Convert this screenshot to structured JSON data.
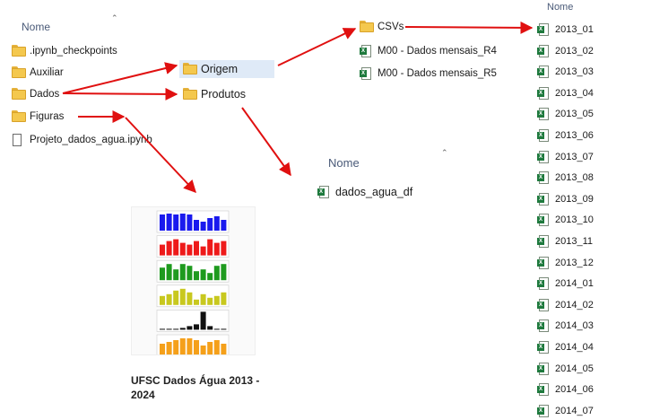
{
  "left_pane": {
    "header": "Nome",
    "items": [
      {
        "label": ".ipynb_checkpoints",
        "icon": "folder-icon"
      },
      {
        "label": "Auxiliar",
        "icon": "folder-icon"
      },
      {
        "label": "Dados",
        "icon": "folder-icon"
      },
      {
        "label": "Figuras",
        "icon": "folder-icon"
      },
      {
        "label": "Projeto_dados_agua.ipynb",
        "icon": "notebook-file-icon"
      }
    ]
  },
  "dados_pane": {
    "items": [
      {
        "label": "Origem",
        "icon": "folder-icon",
        "selected": true
      },
      {
        "label": "Produtos",
        "icon": "folder-icon"
      }
    ]
  },
  "origem_pane": {
    "items": [
      {
        "label": "CSVs",
        "icon": "folder-icon"
      },
      {
        "label": "M00 - Dados mensais_R4",
        "icon": "excel-file-icon"
      },
      {
        "label": "M00 - Dados mensais_R5",
        "icon": "excel-file-icon"
      }
    ]
  },
  "produtos_pane": {
    "header": "Nome",
    "items": [
      {
        "label": "dados_agua_df",
        "icon": "excel-file-icon"
      }
    ]
  },
  "csvs_pane": {
    "header": "Nome",
    "items": [
      "2013_01",
      "2013_02",
      "2013_03",
      "2013_04",
      "2013_05",
      "2013_06",
      "2013_07",
      "2013_08",
      "2013_09",
      "2013_10",
      "2013_11",
      "2013_12",
      "2014_01",
      "2014_02",
      "2014_03",
      "2014_04",
      "2014_05",
      "2014_06",
      "2014_07"
    ]
  },
  "figuras_pane": {
    "caption": "UFSC Dados Água 2013 - 2024",
    "thumbnail_colors": [
      "#1a1aee",
      "#ee1a1a",
      "#1e9a1e",
      "#c8c81e",
      "#111111",
      "#f5a01a"
    ]
  },
  "arrow_color": "#e01010"
}
